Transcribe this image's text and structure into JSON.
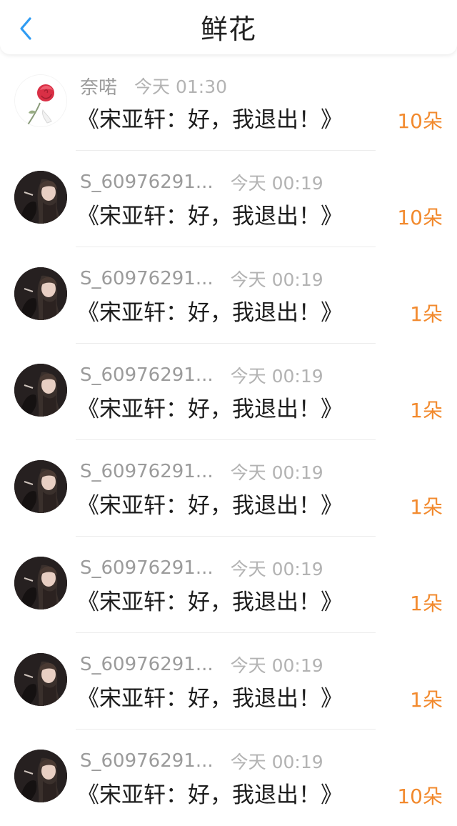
{
  "header": {
    "title": "鲜花"
  },
  "colors": {
    "accent_orange": "#f28a2e",
    "back_arrow_blue": "#2f9cf3",
    "meta_gray": "#9b9b9b"
  },
  "icons": {
    "back": "chevron-left-icon"
  },
  "rows": [
    {
      "username": "奈喏",
      "time": "今天 01:30",
      "title": "《宋亚轩：好，我退出！》",
      "count": "10朵",
      "avatar": "rose"
    },
    {
      "username": "S_60976291...",
      "time": "今天 00:19",
      "title": "《宋亚轩：好，我退出！》",
      "count": "10朵",
      "avatar": "girl"
    },
    {
      "username": "S_60976291...",
      "time": "今天 00:19",
      "title": "《宋亚轩：好，我退出！》",
      "count": "1朵",
      "avatar": "girl"
    },
    {
      "username": "S_60976291...",
      "time": "今天 00:19",
      "title": "《宋亚轩：好，我退出！》",
      "count": "1朵",
      "avatar": "girl"
    },
    {
      "username": "S_60976291...",
      "time": "今天 00:19",
      "title": "《宋亚轩：好，我退出！》",
      "count": "1朵",
      "avatar": "girl"
    },
    {
      "username": "S_60976291...",
      "time": "今天 00:19",
      "title": "《宋亚轩：好，我退出！》",
      "count": "1朵",
      "avatar": "girl"
    },
    {
      "username": "S_60976291...",
      "time": "今天 00:19",
      "title": "《宋亚轩：好，我退出！》",
      "count": "1朵",
      "avatar": "girl"
    },
    {
      "username": "S_60976291...",
      "time": "今天 00:19",
      "title": "《宋亚轩：好，我退出！》",
      "count": "10朵",
      "avatar": "girl"
    }
  ]
}
